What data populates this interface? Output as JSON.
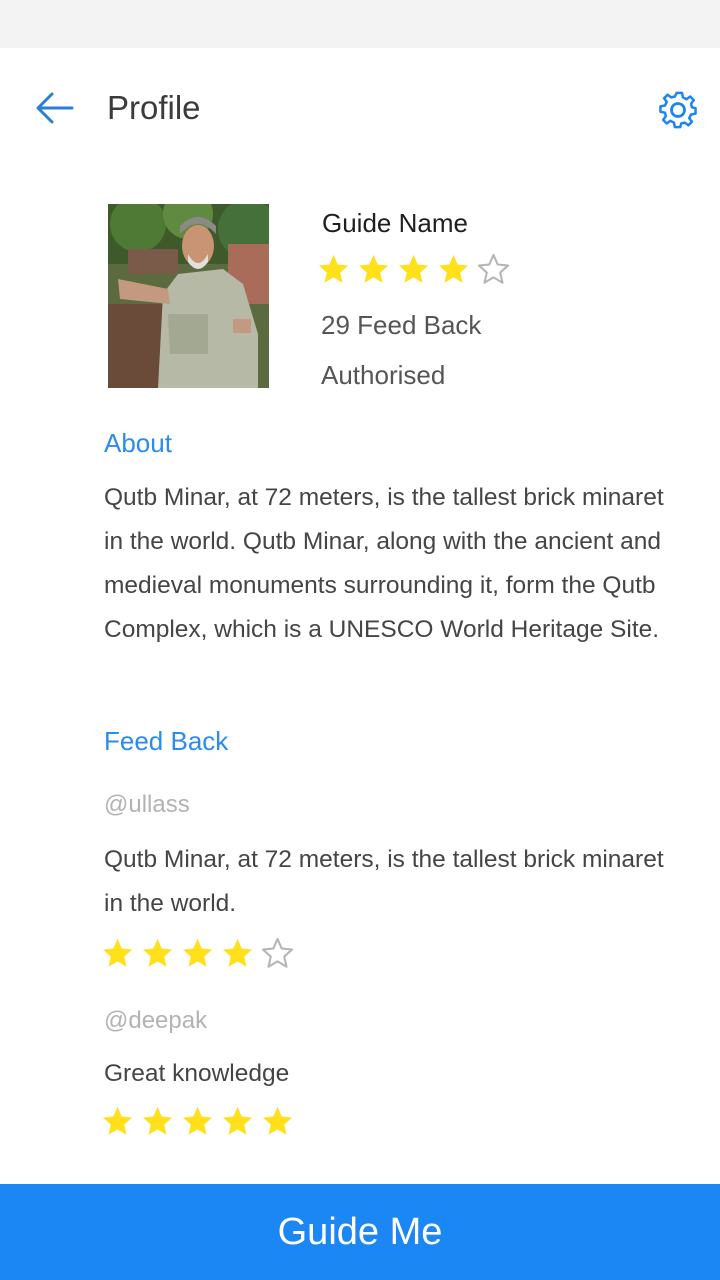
{
  "header": {
    "title": "Profile",
    "back_icon": "arrow-left-icon",
    "settings_icon": "gear-icon",
    "accent_color": "#2a7fd4"
  },
  "profile": {
    "name": "Guide Name",
    "rating": 4,
    "rating_max": 5,
    "feedback_count": "29 Feed Back",
    "status": "Authorised"
  },
  "about": {
    "title": "About",
    "text": "Qutb Minar, at 72 meters, is the tallest brick minaret in the world. Qutb Minar, along with the ancient and medieval monuments surrounding it, form the Qutb Complex, which is a UNESCO World Heritage Site."
  },
  "feedback": {
    "title": "Feed Back",
    "reviews": [
      {
        "user": "@ullass",
        "text": "Qutb Minar, at 72 meters, is the tallest brick minaret in the world.",
        "rating": 4
      },
      {
        "user": "@deepak",
        "text": "Great knowledge",
        "rating": 5
      }
    ]
  },
  "actions": {
    "guide_me_label": "Guide Me"
  },
  "colors": {
    "section_title": "#2a8bf0",
    "button_bg": "#1a87f5",
    "star_filled": "#ffe01b",
    "star_empty": "#b5b5b5"
  }
}
